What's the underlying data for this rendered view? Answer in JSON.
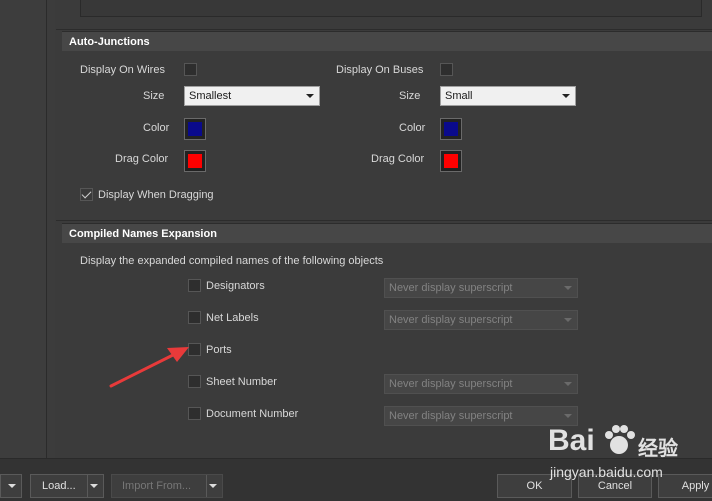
{
  "auto_junctions": {
    "header": "Auto-Junctions",
    "wires": {
      "display_label": "Display On Wires",
      "size_label": "Size",
      "size_value": "Smallest",
      "color_label": "Color",
      "drag_color_label": "Drag Color"
    },
    "buses": {
      "display_label": "Display On Buses",
      "size_label": "Size",
      "size_value": "Small",
      "color_label": "Color",
      "drag_color_label": "Drag Color"
    },
    "display_when_dragging_label": "Display When Dragging",
    "display_when_dragging_checked": true
  },
  "compiled_names": {
    "header": "Compiled Names Expansion",
    "description": "Display the expanded compiled names of the following objects",
    "items": [
      {
        "label": "Designators",
        "select": "Never display superscript"
      },
      {
        "label": "Net Labels",
        "select": "Never display superscript"
      },
      {
        "label": "Ports",
        "select": ""
      },
      {
        "label": "Sheet Number",
        "select": "Never display superscript"
      },
      {
        "label": "Document Number",
        "select": "Never display superscript"
      }
    ]
  },
  "buttons": {
    "load": "Load...",
    "import_from": "Import From...",
    "ok": "OK",
    "cancel": "Cancel",
    "apply": "Apply"
  },
  "watermark": {
    "brand": "Bai",
    "brand2": "经验",
    "url": "jingyan.baidu.com"
  },
  "colors": {
    "junction_color": "#0a0a8c",
    "drag_color": "#ff0000",
    "arrow_color": "#e83a3a"
  }
}
